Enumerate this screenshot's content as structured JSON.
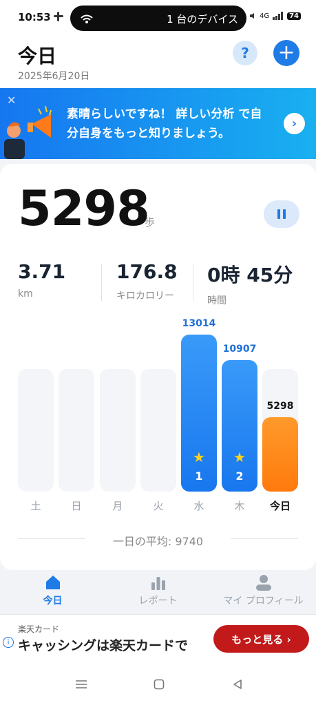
{
  "status_bar": {
    "time": "10:53",
    "island_text": "1 台のデバイス",
    "battery": "74",
    "network": "4G"
  },
  "header": {
    "title": "今日",
    "date": "2025年6月20日",
    "help_label": "?",
    "add_label": "+"
  },
  "banner": {
    "close_label": "✕",
    "text": "素晴らしいですね！ 詳しい分析 で自分自身をもっと知りましょう。",
    "arrow_label": "›"
  },
  "summary": {
    "steps": "5298",
    "steps_unit": "歩",
    "distance_value": "3.71",
    "distance_label": "km",
    "calories_value": "176.8",
    "calories_label": "キロカロリー",
    "time_value": "0時 45分",
    "time_label": "時間"
  },
  "chart_data": {
    "type": "bar",
    "categories": [
      "土",
      "日",
      "月",
      "火",
      "水",
      "木",
      "今日"
    ],
    "values": [
      0,
      0,
      0,
      0,
      13014,
      10907,
      5298
    ],
    "value_labels": [
      "",
      "",
      "",
      "",
      "13014",
      "10907",
      "5298"
    ],
    "ranks": [
      "",
      "",
      "",
      "",
      "1",
      "2",
      ""
    ],
    "colors": {
      "past": "#1f7be6",
      "today": "#ff8a1f",
      "empty": "#f3f5f8"
    }
  },
  "average": {
    "text": "一日の平均: 9740"
  },
  "bottom_nav": {
    "today": "今日",
    "report": "レポート",
    "profile": "マイ プロフィール"
  },
  "ad": {
    "brand": "楽天カード",
    "headline": "キャッシングは楽天カードで",
    "cta": "もっと見る ›"
  }
}
